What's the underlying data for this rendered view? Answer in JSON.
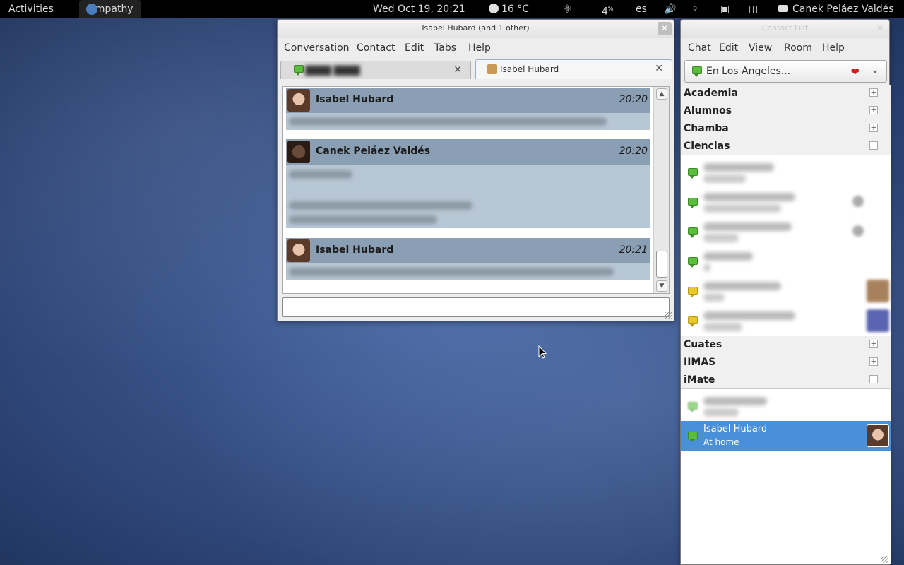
{
  "topbar": {
    "activities": "Activities",
    "app_name": "Empathy",
    "clock": "Wed Oct 19, 20:21",
    "weather": "16 °C",
    "counter": "4",
    "counter_sup": "%",
    "language": "es",
    "user_name": "Canek Peláez Valdés",
    "icons": [
      "accessibility-icon",
      "volume-icon",
      "bluetooth-icon",
      "network-icon",
      "battery-icon",
      "chat-status-icon"
    ]
  },
  "chat_window": {
    "title": "Isabel Hubard (and 1 other)",
    "menu": [
      "Conversation",
      "Contact",
      "Edit",
      "Tabs",
      "Help"
    ],
    "tabs": [
      {
        "label": "",
        "active": false
      },
      {
        "label": "Isabel Hubard",
        "active": true
      }
    ],
    "messages": [
      {
        "sender": "Isabel Hubard",
        "time": "20:20"
      },
      {
        "sender": "Canek Peláez Valdés",
        "time": "20:20"
      },
      {
        "sender": "Isabel Hubard",
        "time": "20:21"
      }
    ],
    "input_value": ""
  },
  "contact_list": {
    "title": "Contact List",
    "menu": [
      "Chat",
      "Edit",
      "View",
      "Room",
      "Help"
    ],
    "status_message": "En Los Angeles...",
    "groups": [
      {
        "name": "Academia",
        "expanded": false
      },
      {
        "name": "Alumnos",
        "expanded": false
      },
      {
        "name": "Chamba",
        "expanded": false
      },
      {
        "name": "Ciencias",
        "expanded": true
      },
      {
        "name": "Cuates",
        "expanded": false
      },
      {
        "name": "IIMAS",
        "expanded": false
      },
      {
        "name": "iMate",
        "expanded": true
      }
    ],
    "selected_contact": {
      "name": "Isabel Hubard",
      "status": "At home"
    }
  },
  "colors": {
    "selection": "#4a90d9",
    "available": "#5bbd3d",
    "away": "#e8c82a",
    "message_header": "#8a9fb3",
    "message_body": "#b8c7d4"
  }
}
